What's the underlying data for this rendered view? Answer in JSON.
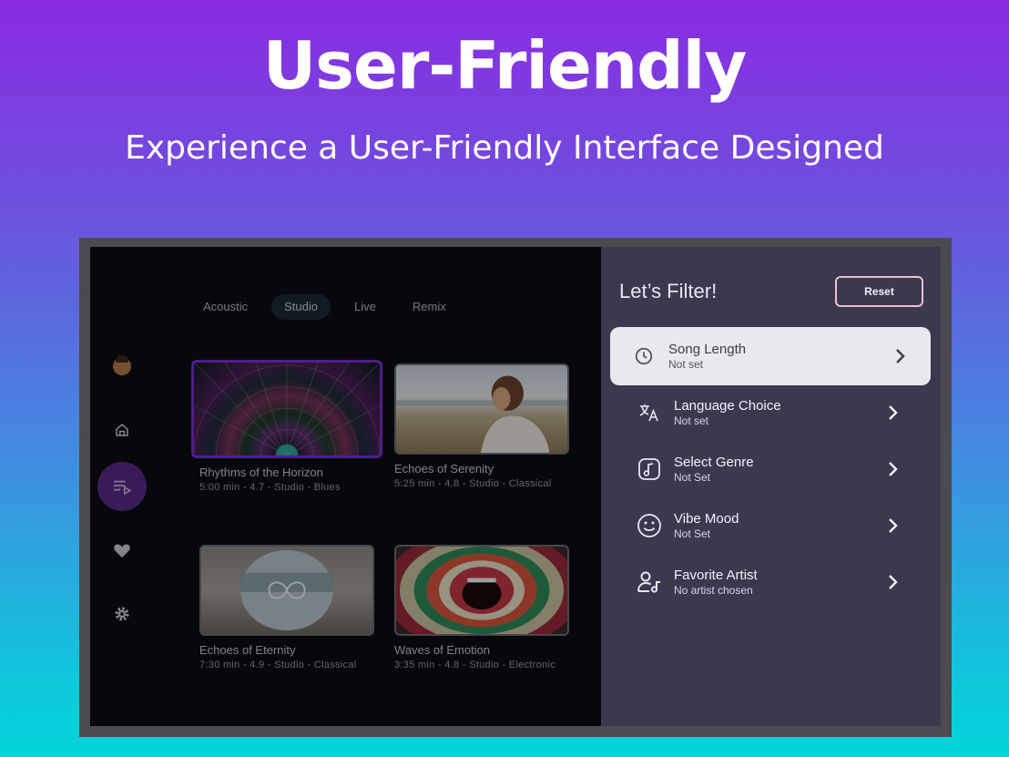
{
  "hero": {
    "title": "User-Friendly",
    "subtitle": "Experience a User-Friendly Interface Designed"
  },
  "sidebar": {
    "items": [
      {
        "icon": "avatar-icon"
      },
      {
        "icon": "home-icon"
      },
      {
        "icon": "playlist-icon",
        "active": true
      },
      {
        "icon": "heart-icon"
      },
      {
        "icon": "gear-icon"
      }
    ]
  },
  "tabs": [
    "Acoustic",
    "Studio",
    "Live",
    "Remix"
  ],
  "active_tab": "Studio",
  "songs": [
    {
      "title": "Rhythms of the Horizon",
      "meta": "5:00 min  - 4.7 - Studio - Blues"
    },
    {
      "title": "Echoes of Serenity",
      "meta": "5:25 min  - 4.8 - Studio - Classical"
    },
    {
      "title": "Echoes of Eternity",
      "meta": "7:30 min  - 4.9 - Studio - Classical"
    },
    {
      "title": "Waves of Emotion",
      "meta": "3:35 min  - 4.8 - Studio - Electronic"
    }
  ],
  "filter": {
    "title": "Let’s Filter!",
    "reset_label": "Reset",
    "items": [
      {
        "label": "Song Length",
        "value": "Not set",
        "icon": "clock-icon"
      },
      {
        "label": "Language Choice",
        "value": "Not set",
        "icon": "translate-icon"
      },
      {
        "label": "Select Genre",
        "value": "Not Set",
        "icon": "music-note-icon"
      },
      {
        "label": "Vibe Mood",
        "value": "Not Set",
        "icon": "smiley-icon"
      },
      {
        "label": "Favorite Artist",
        "value": "No artist chosen",
        "icon": "artist-icon"
      }
    ]
  },
  "colors": {
    "accent": "#7a2fd0",
    "panel": "#3c3850",
    "reset_border": "#f0c0cc"
  }
}
